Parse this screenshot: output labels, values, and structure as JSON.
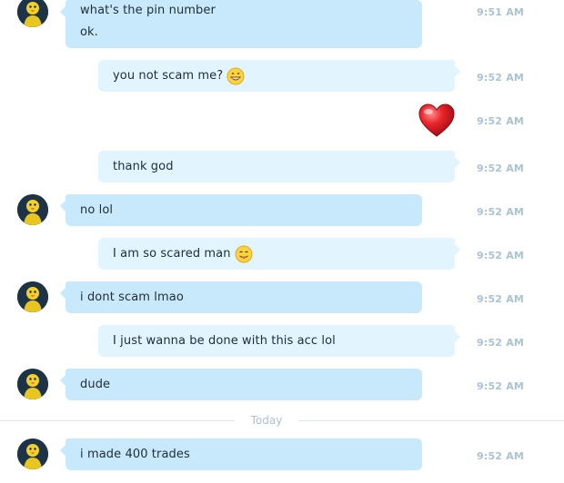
{
  "messages": [
    {
      "id": "m1",
      "direction": "in",
      "lines": [
        "what's the pin number",
        "ok."
      ],
      "time": "9:51 AM"
    },
    {
      "id": "m2",
      "direction": "out",
      "text": "you not scam me?",
      "emoji": "grinning-sweat-emoji",
      "time": "9:52 AM"
    },
    {
      "id": "m3",
      "direction": "out",
      "sticker": "red-heart-icon",
      "time": "9:52 AM"
    },
    {
      "id": "m4",
      "direction": "out",
      "text": "thank god",
      "time": "9:52 AM"
    },
    {
      "id": "m5",
      "direction": "in",
      "text": "no lol",
      "time": "9:52 AM"
    },
    {
      "id": "m6",
      "direction": "out",
      "text": "I am so scared man",
      "emoji": "tongue-out-emoji",
      "time": "9:52 AM"
    },
    {
      "id": "m7",
      "direction": "in",
      "text": "i dont scam lmao",
      "time": "9:52 AM"
    },
    {
      "id": "m8",
      "direction": "out",
      "text": "I just wanna be done with this acc lol",
      "time": "9:52 AM"
    },
    {
      "id": "m9",
      "direction": "in",
      "text": "dude",
      "time": "9:52 AM"
    },
    {
      "id": "m10",
      "direction": "in",
      "text": "i made 400 trades",
      "time": "9:52 AM"
    }
  ],
  "date_divider": "Today",
  "colors": {
    "incoming_bubble": "#c8e9fb",
    "outgoing_bubble": "#e2f4fd",
    "timestamp": "#a9c3d2",
    "avatar_bg": "#1d3447"
  }
}
